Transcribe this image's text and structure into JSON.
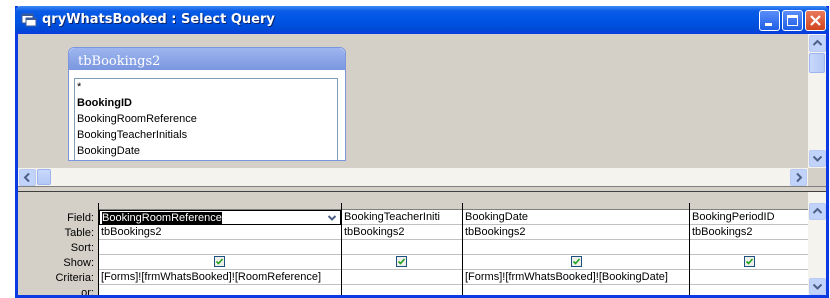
{
  "window": {
    "title": "qryWhatsBooked : Select Query"
  },
  "field_list": {
    "table_name": "tbBookings2",
    "items": [
      {
        "label": "*",
        "bold": false
      },
      {
        "label": "BookingID",
        "bold": true
      },
      {
        "label": "BookingRoomReference",
        "bold": false
      },
      {
        "label": "BookingTeacherInitials",
        "bold": false
      },
      {
        "label": "BookingDate",
        "bold": false
      }
    ]
  },
  "grid": {
    "row_labels": {
      "field": "Field:",
      "table": "Table:",
      "sort": "Sort:",
      "show": "Show:",
      "criteria": "Criteria:",
      "or": "or:"
    },
    "columns": [
      {
        "field": "BookingRoomReference",
        "table": "tbBookings2",
        "sort": "",
        "show": true,
        "criteria": "[Forms]![frmWhatsBooked]![RoomReference]",
        "or": ""
      },
      {
        "field": "BookingTeacherIniti",
        "table": "tbBookings2",
        "sort": "",
        "show": true,
        "criteria": "",
        "or": ""
      },
      {
        "field": "BookingDate",
        "table": "tbBookings2",
        "sort": "",
        "show": true,
        "criteria": "[Forms]![frmWhatsBooked]![BookingDate]",
        "or": ""
      },
      {
        "field": "BookingPeriodID",
        "table": "tbBookings2",
        "sort": "",
        "show": true,
        "criteria": "",
        "or": ""
      }
    ]
  },
  "colors": {
    "titlebar": "#0055e5",
    "field_list_header": "#7a96df",
    "checkbox_check": "#21a121"
  }
}
